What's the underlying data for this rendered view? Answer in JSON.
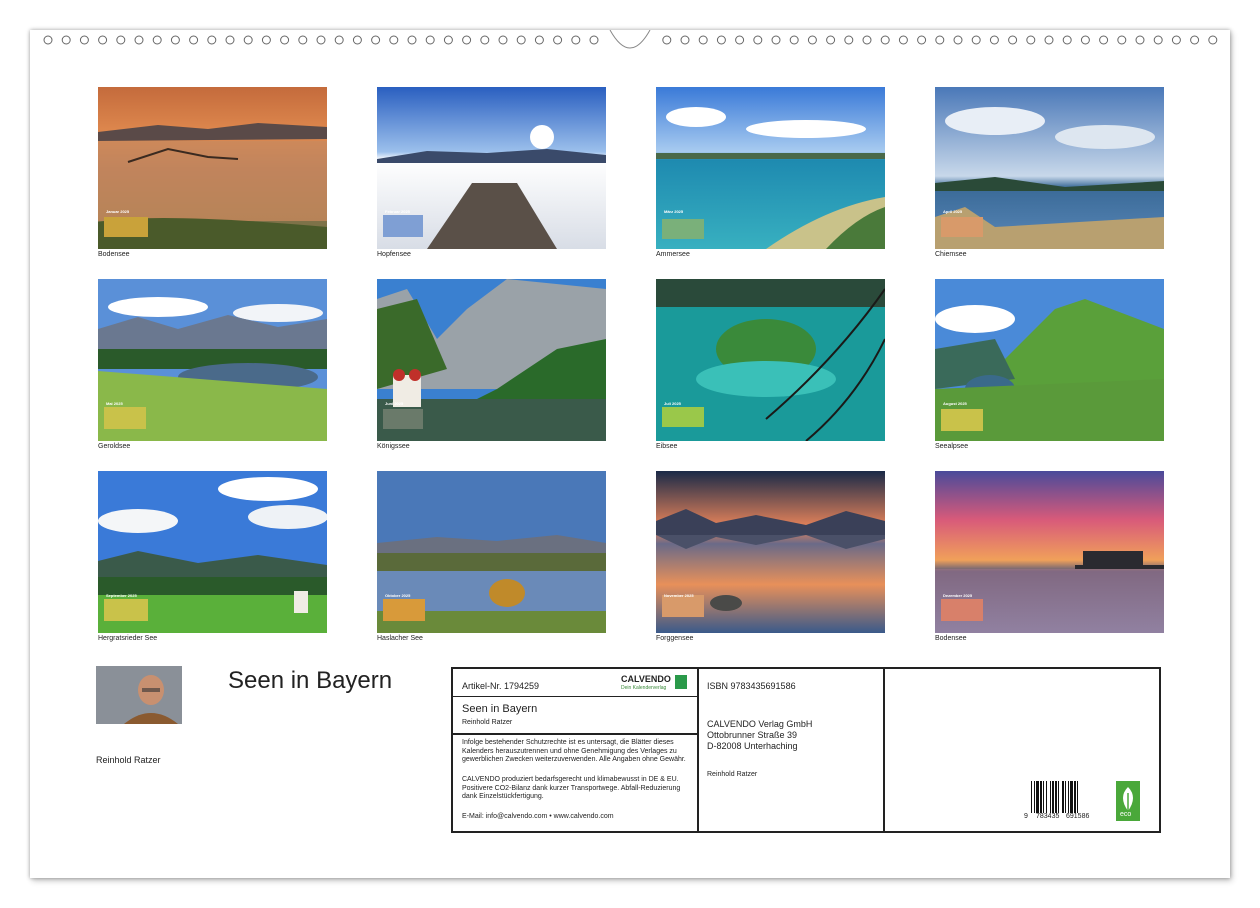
{
  "calendar_title": "Seen in Bayern",
  "author": "Reinhold Ratzer",
  "tiles": [
    {
      "caption": "Bodensee",
      "month": "Januar 2025"
    },
    {
      "caption": "Hopfensee",
      "month": "Februar 2025"
    },
    {
      "caption": "Ammersee",
      "month": "März 2025"
    },
    {
      "caption": "Chiemsee",
      "month": "April 2025"
    },
    {
      "caption": "Geroldsee",
      "month": "Mai 2025"
    },
    {
      "caption": "Königssee",
      "month": "Juni 2025"
    },
    {
      "caption": "Eibsee",
      "month": "Juli 2025"
    },
    {
      "caption": "Seealpsee",
      "month": "August 2025"
    },
    {
      "caption": "Hergratsrieder See",
      "month": "September 2025"
    },
    {
      "caption": "Haslacher See",
      "month": "Oktober 2025"
    },
    {
      "caption": "Forggensee",
      "month": "November 2025"
    },
    {
      "caption": "Bodensee",
      "month": "Dezember 2025"
    }
  ],
  "info": {
    "article": "Artikel-Nr. 1794259",
    "brand": "CALVENDO",
    "brand_tagline": "Dein Kalenderverlag",
    "title": "Seen in Bayern",
    "author": "Reinhold Ratzer",
    "legal1": "Infolge bestehender Schutzrechte ist es untersagt, die Blätter dieses Kalenders herauszutrennen und ohne Genehmigung des Verlages zu gewerblichen Zwecken weiterzuverwenden. Alle Angaben ohne Gewähr.",
    "legal2": "CALVENDO produziert bedarfsgerecht und klimabewusst in DE & EU. Positivere CO2-Bilanz dank kurzer Transportwege. Abfall-Reduzierung dank Einzelstückfertigung.",
    "contact": "E-Mail: info@calvendo.com • www.calvendo.com",
    "isbn": "ISBN 9783435691586",
    "publisher": "CALVENDO Verlag GmbH",
    "street": "Ottobrunner Straße 39",
    "city": "D-82008 Unterhaching",
    "author2": "Reinhold Ratzer",
    "barcode_left": "9",
    "barcode_mid": "783435",
    "barcode_right": "691586",
    "eco_label": "eco"
  }
}
